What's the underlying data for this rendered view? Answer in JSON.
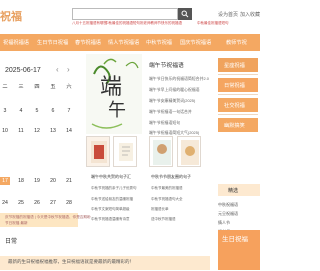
{
  "header": {
    "logo": "祝福",
    "search_placeholder": "",
    "hot_links": [
      "八月十五祝福语有哪些",
      "中秋最佳的祝福语短句",
      "祝老师教师节快乐的祝福语",
      "中秋最佳祝福语短句"
    ],
    "top_links": [
      "设为首页",
      "加入收藏"
    ]
  },
  "nav": {
    "items": [
      "祝福祝福语",
      "生日节日祝福",
      "春节祝福语",
      "情人节祝福语",
      "中秋节祝福",
      "国庆节祝福语",
      "教师节祝"
    ]
  },
  "calendar": {
    "date": "2025-06-17",
    "prev": "‹",
    "next": "›",
    "weekdays": [
      "二",
      "三",
      "四",
      "五",
      "六"
    ],
    "weeks": [
      [
        "3",
        "4",
        "5",
        "6",
        "7"
      ],
      [
        "10",
        "11",
        "12",
        "13",
        "14"
      ],
      [
        "17",
        "18",
        "19",
        "20",
        "21"
      ],
      [
        "24",
        "25",
        "26",
        "27",
        "28"
      ]
    ]
  },
  "festival": {
    "lines": [
      "庆节祝福的祝福语 | 今天是中秋节祝福语、你是否期盼",
      "节日祝福 最新"
    ]
  },
  "feature": {
    "title": "端午节祝福语",
    "links": [
      "端午节日快乐的祝福语简短合并2.0",
      "端午节早上问候的暖心祝福语",
      "端午节安康精美贺词(2025)",
      "端午节祝福语一句话合并",
      "端午节祝福语短句",
      "端午节祝福语简短大气(2025)"
    ]
  },
  "thumbs": {
    "captions": [
      "端午中秋共贺的句子汇",
      "中秋节节朋友圈的句子"
    ],
    "links_left": [
      "中秋节祝福的亲子儿子优秀句",
      "中秋节送给朋友的温暖祝福",
      "中秋节文案短句简单超级",
      "中秋节祝福语温暖有诗意"
    ],
    "links_right": [
      "中秋节最美的祝福语",
      "中秋节祝福语句大全",
      "祝福语长辈",
      "送中秋节祝福语"
    ]
  },
  "sidebar": {
    "tabs": [
      "星座祝福",
      "日常祝福",
      "社交祝福",
      "幽默搞笑"
    ],
    "section_title": "精选",
    "links": [
      "中秋祝福语",
      "元旦祝福语",
      "情人节",
      "祝老师",
      "七夕节",
      "母亲节",
      "护士节",
      "劳动节",
      "重阳节",
      "新年"
    ],
    "banner": "生日祝福"
  },
  "daily": {
    "label": "日常",
    "text": "最新的生日祝福祝福推荐，生日祝福语就是要最新的最精彩的！"
  },
  "colors": {
    "accent": "#f4a862",
    "tab_1": "#f0a35d",
    "tab_2": "#f5a560",
    "tab_3": "#f4a862",
    "tab_4": "#f4a862"
  }
}
